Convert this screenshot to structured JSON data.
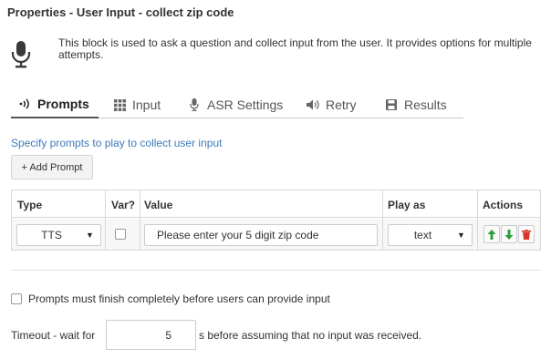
{
  "header": {
    "title": "Properties - User Input - collect zip code"
  },
  "intro": {
    "icon": "microphone-icon",
    "description": "This block is used to ask a question and collect input from the user. It provides options for multiple attempts."
  },
  "tabs": [
    {
      "label": "Prompts",
      "icon": "voice-waves-icon",
      "active": true
    },
    {
      "label": "Input",
      "icon": "grid-icon",
      "active": false
    },
    {
      "label": "ASR Settings",
      "icon": "microphone-icon",
      "active": false
    },
    {
      "label": "Retry",
      "icon": "speaker-icon",
      "active": false
    },
    {
      "label": "Results",
      "icon": "floppy-disk-icon",
      "active": false
    }
  ],
  "prompts": {
    "instruction": "Specify prompts to play to collect user input",
    "add_label": "+ Add Prompt",
    "columns": [
      "Type",
      "Var?",
      "Value",
      "Play as",
      "Actions"
    ],
    "rows": [
      {
        "type": "TTS",
        "var": false,
        "value": "Please enter your 5 digit zip code",
        "play_as": "text"
      }
    ]
  },
  "options": {
    "must_finish_label": "Prompts must finish completely before users can provide input",
    "must_finish_checked": false,
    "timeout_prefix": "Timeout - wait for",
    "timeout_value": "5",
    "timeout_suffix": "s before assuming that no input was received."
  },
  "colors": {
    "link": "#3d7bbb",
    "up_arrow": "#2e9e3a",
    "down_arrow": "#2e9e3a",
    "delete": "#d9342b"
  }
}
